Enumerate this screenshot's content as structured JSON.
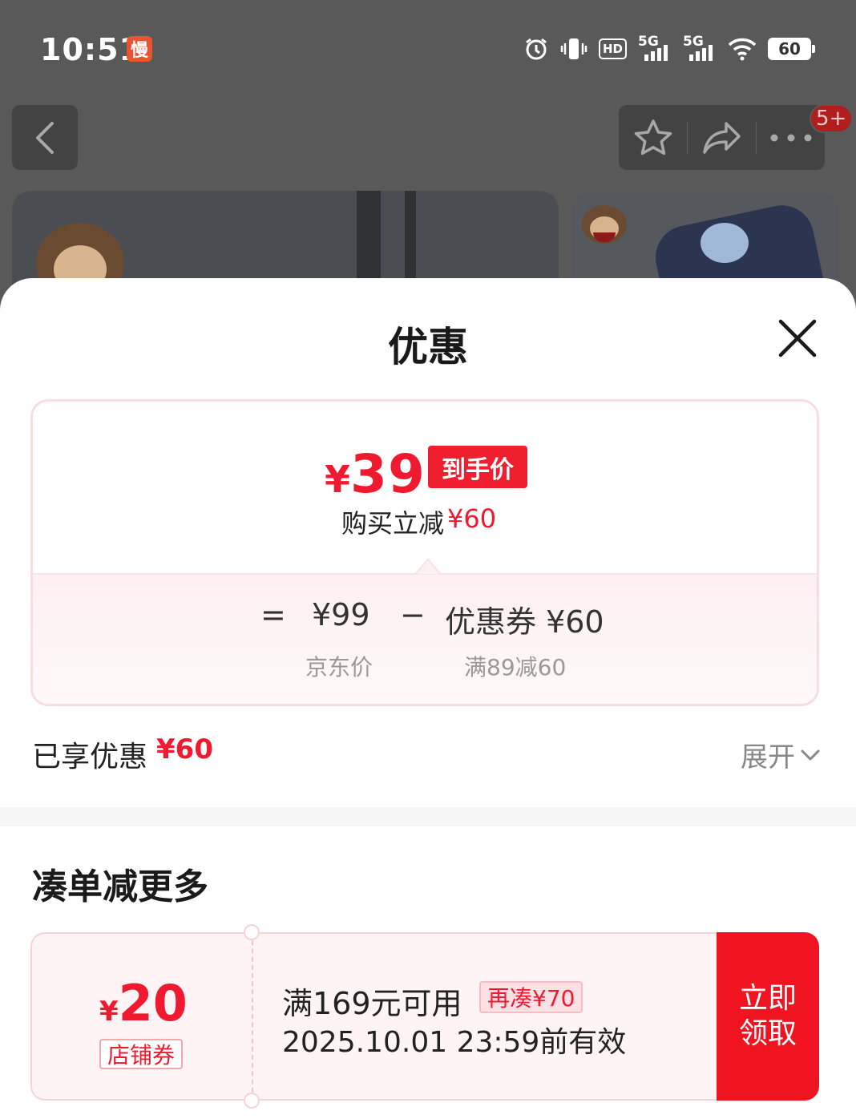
{
  "status_bar": {
    "time": "10:51",
    "slow_badge": "慢",
    "hd_label": "HD",
    "network_1": "5G",
    "network_2": "5G",
    "battery": "60"
  },
  "top_bar": {
    "message_badge": "5+"
  },
  "sheet": {
    "title": "优惠",
    "final_price_currency": "¥",
    "final_price_value": "39",
    "final_price_tag": "到手价",
    "promo_text": "购买立减",
    "promo_amount": "¥60",
    "equation": {
      "equals": "=",
      "base_price": "¥99",
      "minus": "−",
      "coupon_text": "优惠券 ¥60",
      "base_label": "京东价",
      "coupon_label": "满89减60"
    },
    "enjoyed_label": "已享优惠",
    "enjoyed_value": "¥60",
    "expand_label": "展开"
  },
  "combine_section": {
    "title": "凑单减更多",
    "coupon": {
      "currency": "¥",
      "amount": "20",
      "type": "店铺券",
      "condition": "满169元可用",
      "more_needed": "再凑¥70",
      "validity": "2025.10.01 23:59前有效",
      "action_line1": "立即",
      "action_line2": "领取"
    }
  },
  "colors": {
    "accent_red": "#f01a30",
    "button_red": "#ef1420",
    "overlay_gray": "#595959"
  }
}
